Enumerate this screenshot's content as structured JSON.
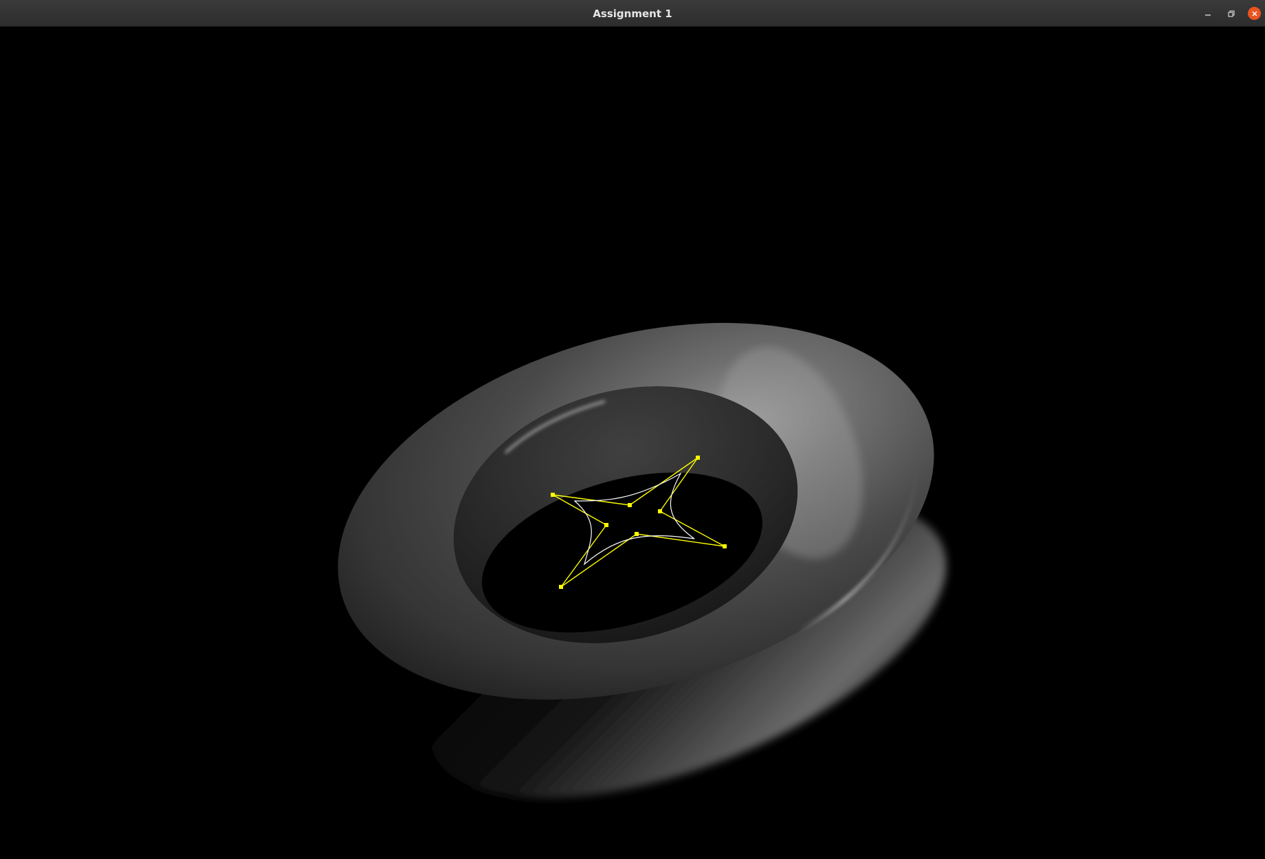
{
  "window": {
    "title": "Assignment 1"
  },
  "controls": {
    "minimize_icon": "minimize-icon",
    "maximize_icon": "restore-icon",
    "close_icon": "close-icon",
    "close_color": "#e95420"
  },
  "scene": {
    "background": "#000000",
    "objects": [
      "torus",
      "bezier-control-polygon",
      "bezier-curve"
    ],
    "control_polygon_color": "#ffff00",
    "curve_color": "#ffffff"
  }
}
